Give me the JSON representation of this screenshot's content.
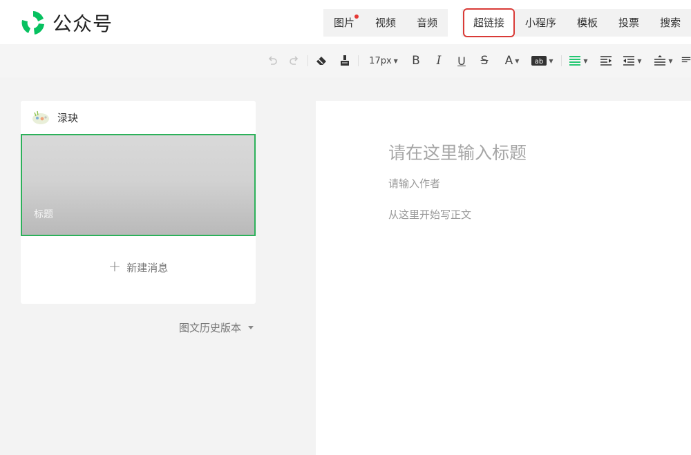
{
  "header": {
    "logo_text": "公众号",
    "brand_color": "#07c160",
    "tabs_group1": [
      {
        "label": "图片",
        "has_dot": true
      },
      {
        "label": "视频"
      },
      {
        "label": "音频"
      }
    ],
    "tabs_group2": [
      {
        "label": "超链接",
        "highlighted": true
      },
      {
        "label": "小程序"
      },
      {
        "label": "模板"
      },
      {
        "label": "投票"
      },
      {
        "label": "搜索"
      }
    ]
  },
  "toolbar": {
    "font_size": "17px",
    "icons": [
      "undo-icon",
      "redo-icon",
      "eraser-icon",
      "format-painter-icon",
      "font-size-dropdown",
      "bold-icon",
      "italic-icon",
      "underline-icon",
      "strikethrough-icon",
      "font-color-icon",
      "background-color-icon",
      "align-justify-icon",
      "indent-icon",
      "outdent-icon",
      "line-height-icon",
      "list-icon"
    ],
    "active_color": "#07c160"
  },
  "sidebar": {
    "account_name": "渌玦",
    "cover_title": "标题",
    "new_message": "新建消息",
    "history": "图文历史版本",
    "selected_border_color": "#2cb15a"
  },
  "editor": {
    "title_placeholder": "请在这里输入标题",
    "author_placeholder": "请输入作者",
    "body_placeholder": "从这里开始写正文"
  }
}
